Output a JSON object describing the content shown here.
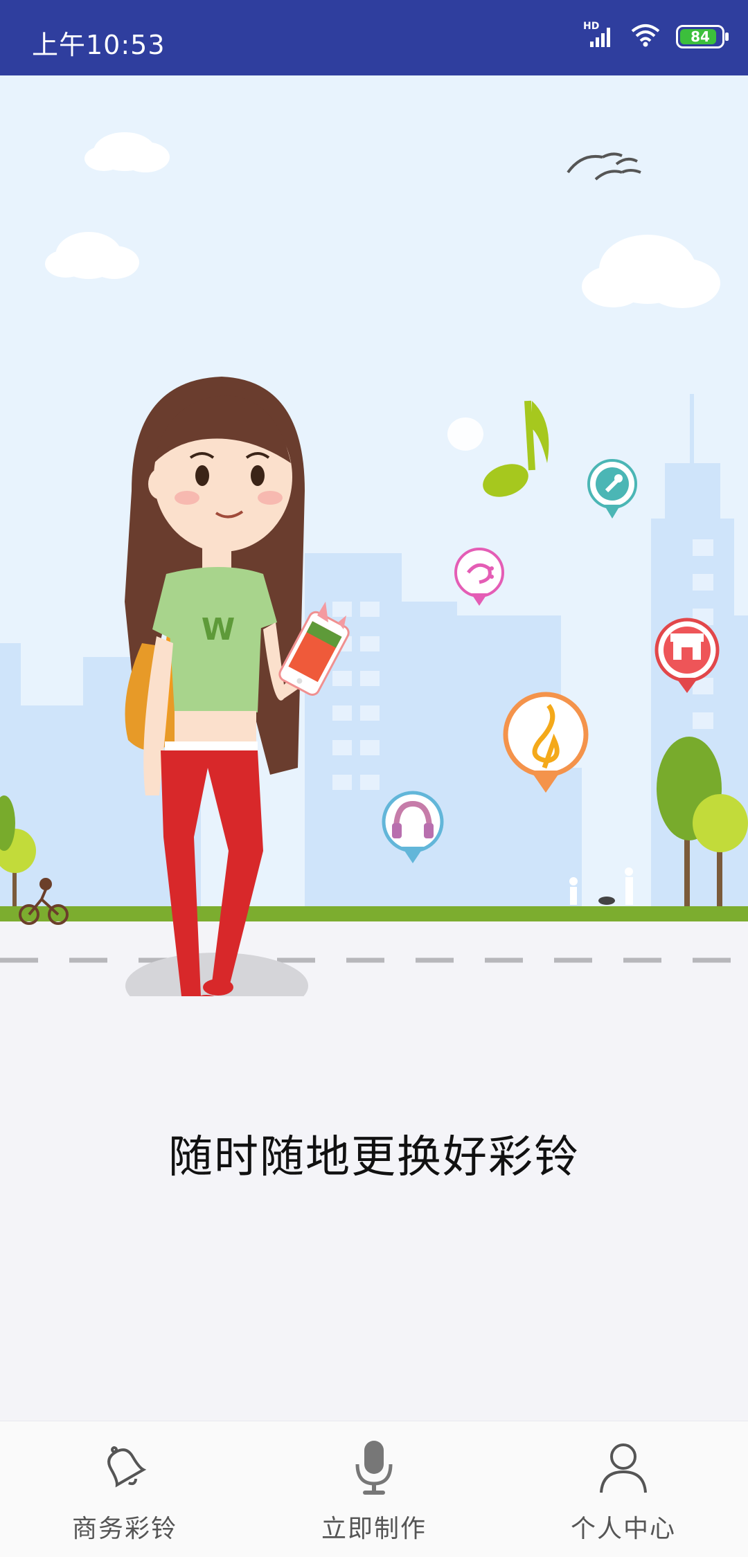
{
  "status_bar": {
    "time": "上午10:53",
    "network": "HD",
    "battery": "84"
  },
  "slogan": "随时随地更换好彩铃",
  "illustration": {
    "shirt_letter": "W"
  },
  "bottom_nav": {
    "items": [
      {
        "label": "商务彩铃",
        "icon": "bell-icon"
      },
      {
        "label": "立即制作",
        "icon": "microphone-icon"
      },
      {
        "label": "个人中心",
        "icon": "person-icon"
      }
    ]
  },
  "colors": {
    "status_bar": "#2f3e9e",
    "sky": "#e6f2fc",
    "grass": "#7cad2f"
  }
}
